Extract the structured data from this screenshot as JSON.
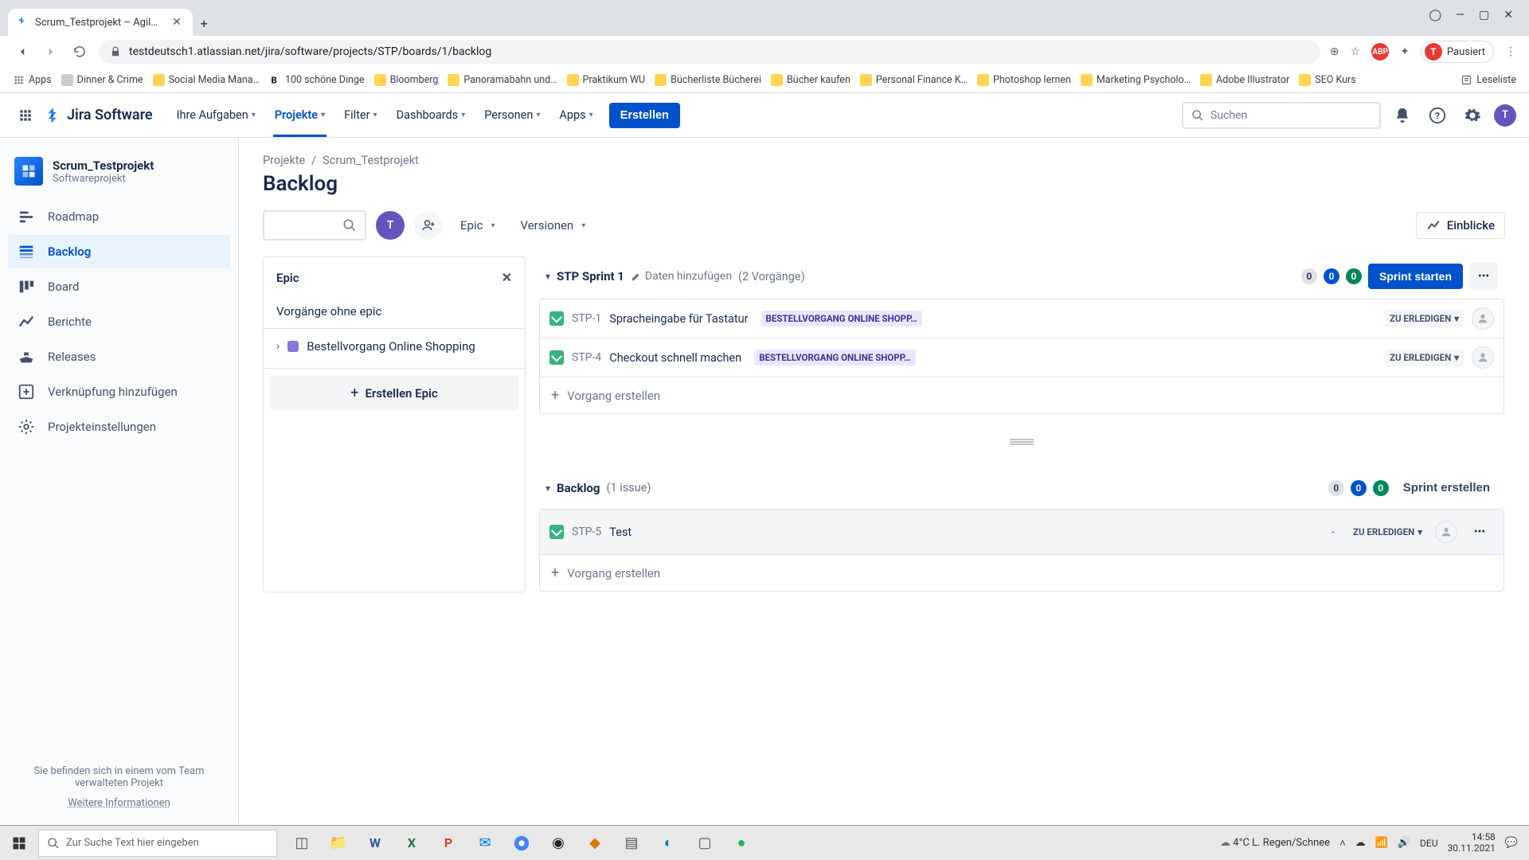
{
  "browser": {
    "tab_title": "Scrum_Testprojekt – Agile-Board",
    "url": "testdeutsch1.atlassian.net/jira/software/projects/STP/boards/1/backlog",
    "profile_status": "Pausiert",
    "bookmarks": {
      "apps": "Apps",
      "items": [
        "Dinner & Crime",
        "Social Media Mana…",
        "100 schöne Dinge",
        "Bloomberg",
        "Panoramabahn und…",
        "Praktikum WU",
        "Bücherliste Bücherei",
        "Bücher kaufen",
        "Personal Finance K…",
        "Photoshop lernen",
        "Marketing Psycholo…",
        "Adobe Illustrator",
        "SEO Kurs"
      ],
      "leseliste": "Leseliste"
    }
  },
  "jiraNav": {
    "product": "Jira Software",
    "items": [
      "Ihre Aufgaben",
      "Projekte",
      "Filter",
      "Dashboards",
      "Personen",
      "Apps"
    ],
    "create": "Erstellen",
    "search_placeholder": "Suchen",
    "avatar_initial": "T"
  },
  "sidebar": {
    "project_name": "Scrum_Testprojekt",
    "project_type": "Softwareprojekt",
    "items": {
      "roadmap": "Roadmap",
      "backlog": "Backlog",
      "board": "Board",
      "reports": "Berichte",
      "releases": "Releases",
      "addlink": "Verknüpfung hinzufügen",
      "settings": "Projekteinstellungen"
    },
    "footer_note": "Sie befinden sich in einem vom Team verwalteten Projekt",
    "footer_link": "Weitere Informationen"
  },
  "breadcrumb": {
    "root": "Projekte",
    "sep": "/",
    "project": "Scrum_Testprojekt"
  },
  "page_title": "Backlog",
  "toolbar": {
    "epic": "Epic",
    "versions": "Versionen",
    "insights": "Einblicke",
    "avatar_initial": "T"
  },
  "epicPanel": {
    "title": "Epic",
    "no_epic": "Vorgänge ohne epic",
    "epic_name": "Bestellvorgang Online Shopping",
    "create": "Erstellen Epic"
  },
  "sprints": {
    "sprint1": {
      "name": "STP Sprint 1",
      "add_dates": "Daten hinzufügen",
      "count": "(2 Vorgänge)",
      "counts": {
        "grey": "0",
        "blue": "0",
        "green": "0"
      },
      "start_btn": "Sprint starten",
      "issues": [
        {
          "key": "STP-1",
          "summary": "Spracheingabe für Tastatur",
          "epic": "BESTELLVORGANG ONLINE SHOPP…",
          "status": "ZU ERLEDIGEN"
        },
        {
          "key": "STP-4",
          "summary": "Checkout schnell machen",
          "epic": "BESTELLVORGANG ONLINE SHOPP…",
          "status": "ZU ERLEDIGEN"
        }
      ],
      "create": "Vorgang erstellen"
    },
    "backlog": {
      "name": "Backlog",
      "count": "(1 issue)",
      "counts": {
        "grey": "0",
        "blue": "0",
        "green": "0"
      },
      "create_sprint_btn": "Sprint erstellen",
      "issues": [
        {
          "key": "STP-5",
          "summary": "Test",
          "status": "ZU ERLEDIGEN",
          "est": "-"
        }
      ],
      "create": "Vorgang erstellen"
    }
  },
  "taskbar": {
    "search_placeholder": "Zur Suche Text hier eingeben",
    "weather": "4°C  L. Regen/Schnee",
    "time": "14:58",
    "date": "30.11.2021"
  }
}
